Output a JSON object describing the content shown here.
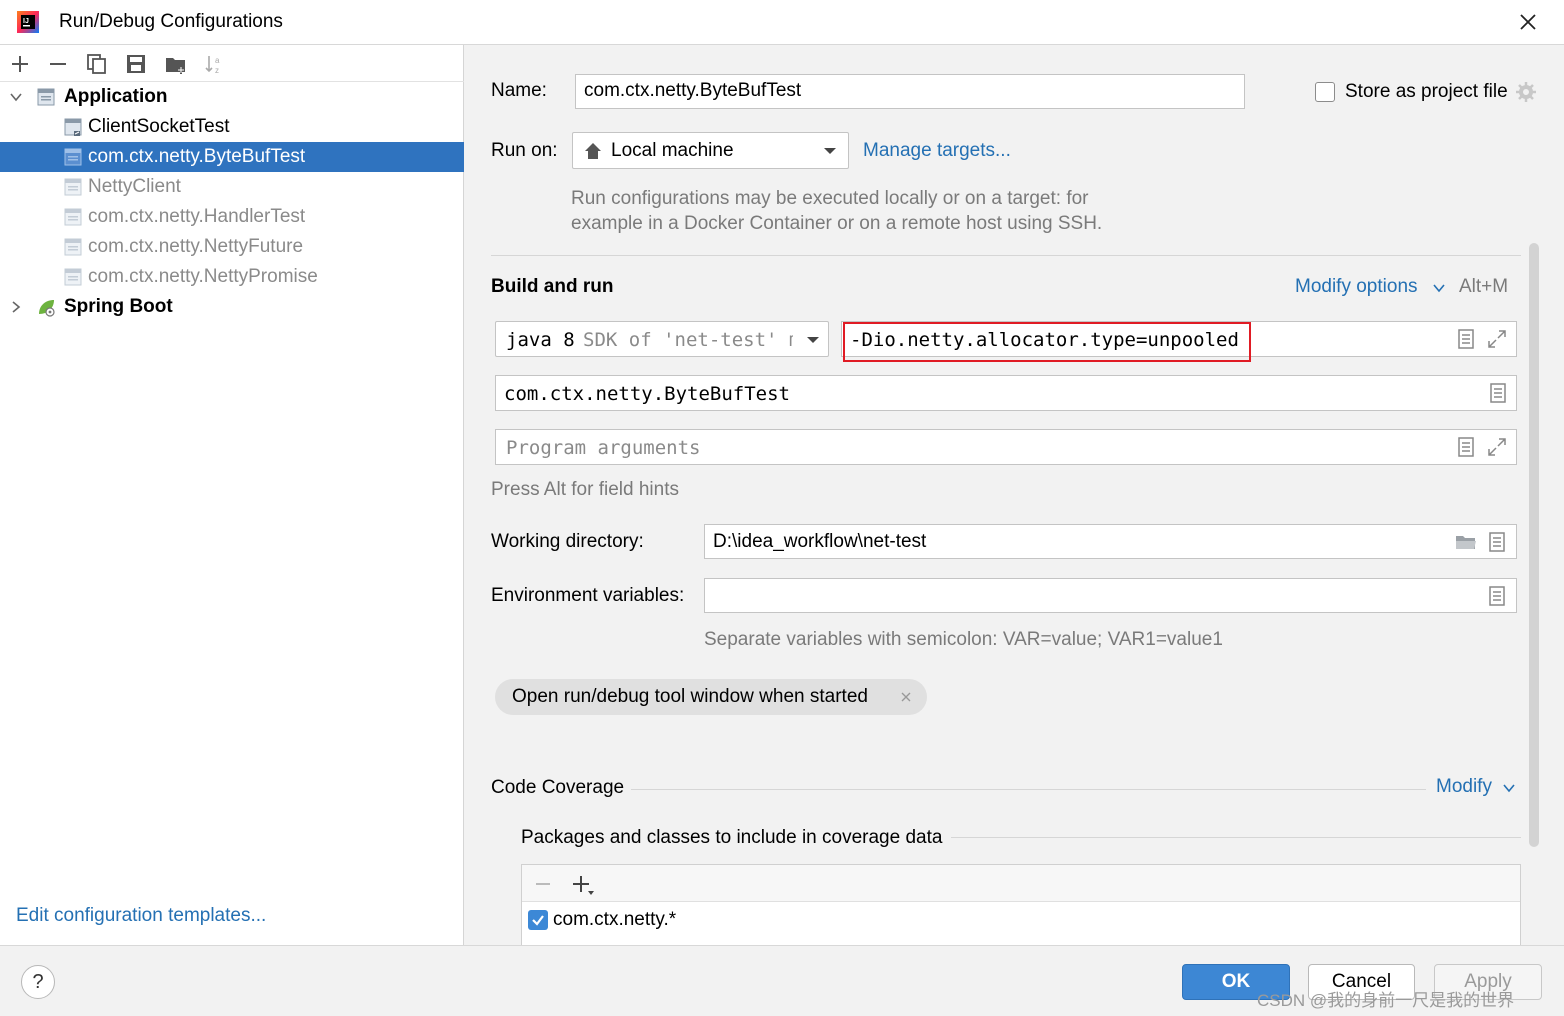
{
  "window": {
    "title": "Run/Debug Configurations"
  },
  "tree": {
    "groups": [
      {
        "label": "Application",
        "items": [
          "ClientSocketTest",
          "com.ctx.netty.ByteBufTest",
          "NettyClient",
          "com.ctx.netty.HandlerTest",
          "com.ctx.netty.NettyFuture",
          "com.ctx.netty.NettyPromise"
        ]
      },
      {
        "label": "Spring Boot",
        "items": []
      }
    ],
    "selected": "com.ctx.netty.ByteBufTest",
    "edit_templates_link": "Edit configuration templates..."
  },
  "form": {
    "name_label": "Name:",
    "name_value": "com.ctx.netty.ByteBufTest",
    "store_as_project_file": "Store as project file",
    "run_on_label": "Run on:",
    "run_on_value": "Local machine",
    "manage_targets": "Manage targets...",
    "run_on_hint_line1": "Run configurations may be executed locally or on a target: for",
    "run_on_hint_line2": "example in a Docker Container or on a remote host using SSH.",
    "build_and_run": "Build and run",
    "modify_options": "Modify options",
    "modify_options_shortcut": "Alt+M",
    "jre_java": "java 8",
    "jre_rest": "SDK of 'net-test' mo",
    "vm_options": "-Dio.netty.allocator.type=unpooled",
    "main_class": "com.ctx.netty.ByteBufTest",
    "program_args_placeholder": "Program arguments",
    "field_hint": "Press Alt for field hints",
    "working_dir_label": "Working directory:",
    "working_dir_value": "D:\\idea_workflow\\net-test",
    "env_vars_label": "Environment variables:",
    "env_vars_value": "",
    "env_vars_hint": "Separate variables with semicolon: VAR=value; VAR1=value1",
    "open_tool_window_chip": "Open run/debug tool window when started",
    "code_coverage": "Code Coverage",
    "coverage_modify": "Modify",
    "coverage_packages_label": "Packages and classes to include in coverage data",
    "coverage_entry": "com.ctx.netty.*"
  },
  "buttons": {
    "help": "?",
    "ok": "OK",
    "cancel": "Cancel",
    "apply": "Apply"
  },
  "watermark": "CSDN @我的身前一尺是我的世界",
  "colors": {
    "selection": "#2f73bf",
    "link": "#2470b3",
    "highlight_box": "#e01b24",
    "ok_button": "#3d87d4"
  }
}
